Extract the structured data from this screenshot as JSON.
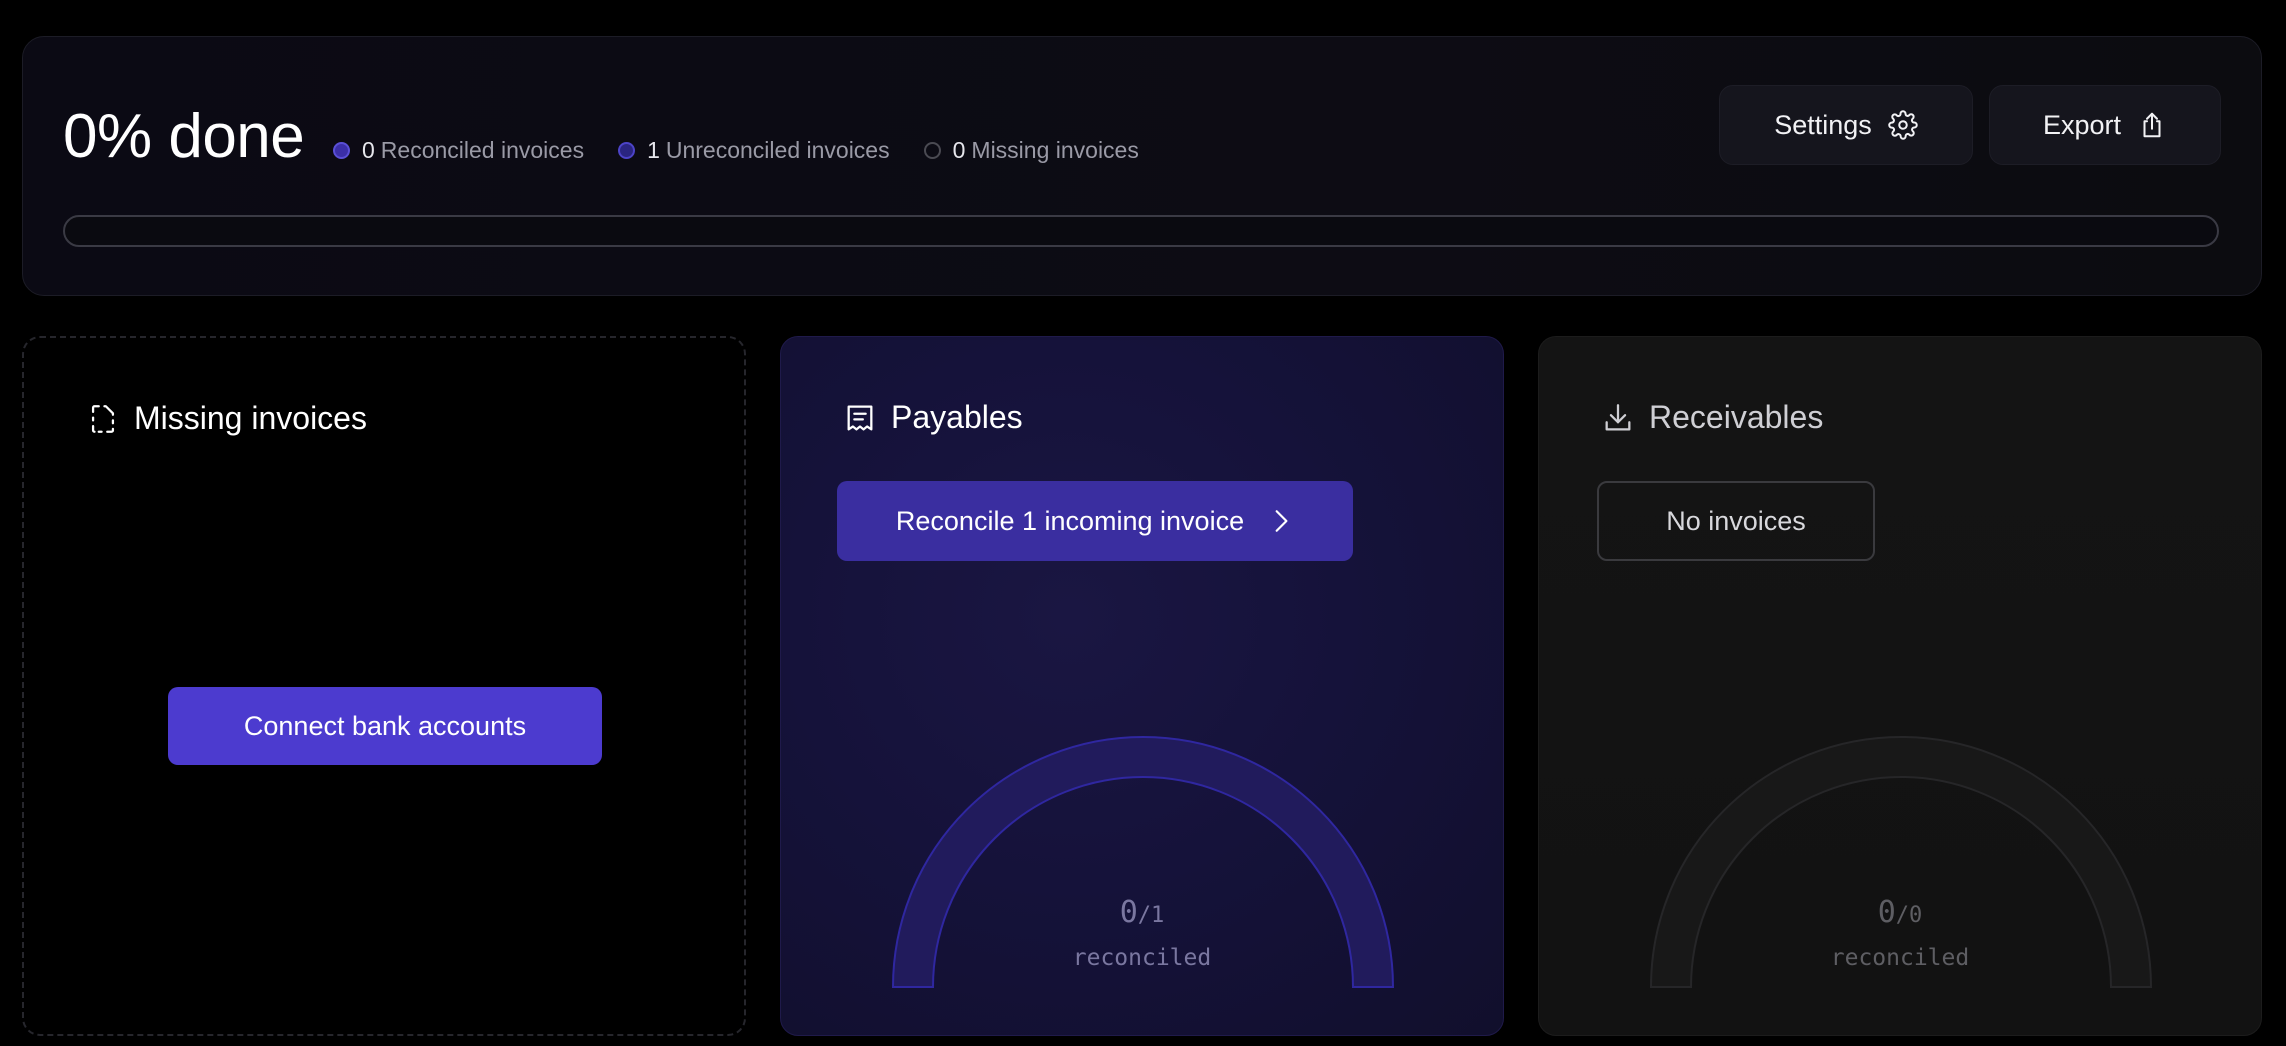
{
  "summary": {
    "title": "0% done",
    "progress_percent": 0,
    "stats": [
      {
        "count": "0",
        "label": "Reconciled invoices"
      },
      {
        "count": "1",
        "label": "Unreconciled invoices"
      },
      {
        "count": "0",
        "label": "Missing invoices"
      }
    ],
    "settings_label": "Settings",
    "export_label": "Export"
  },
  "missing": {
    "title": "Missing invoices",
    "connect_label": "Connect bank accounts"
  },
  "payables": {
    "title": "Payables",
    "reconcile_label": "Reconcile 1 incoming invoice",
    "reconciled": "0",
    "total": "/1",
    "caption": "reconciled"
  },
  "receivables": {
    "title": "Receivables",
    "no_invoices_label": "No invoices",
    "reconciled": "0",
    "total": "/0",
    "caption": "reconciled"
  },
  "colors": {
    "accent": "#4c3bcf",
    "payables_gauge": "#231d66",
    "receivables_gauge": "#1c1c1c"
  }
}
